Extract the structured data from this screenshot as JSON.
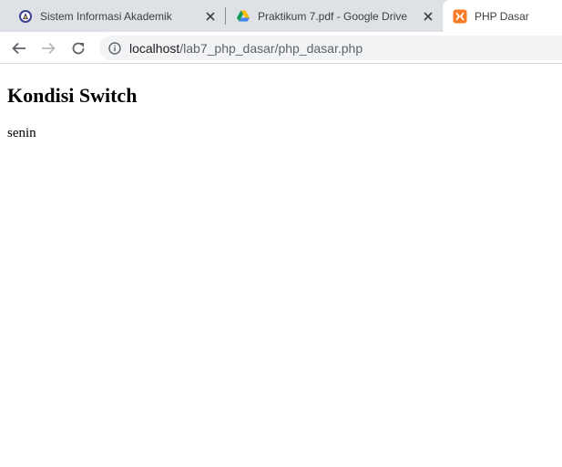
{
  "tabs": [
    {
      "title": "Sistem Informasi Akademik",
      "icon": "university-seal-icon",
      "active": false
    },
    {
      "title": "Praktikum 7.pdf - Google Drive",
      "icon": "google-drive-icon",
      "active": false
    },
    {
      "title": "PHP Dasar",
      "icon": "xampp-icon",
      "active": true
    }
  ],
  "address_bar": {
    "url_host": "localhost",
    "url_path": "/lab7_php_dasar/php_dasar.php",
    "icon": "info-icon"
  },
  "page": {
    "heading": "Kondisi Switch",
    "output": "senin"
  },
  "colors": {
    "tabstrip_bg": "#dee1e6",
    "omnibox_bg": "#f1f3f4",
    "xampp_orange": "#fb7a24"
  }
}
